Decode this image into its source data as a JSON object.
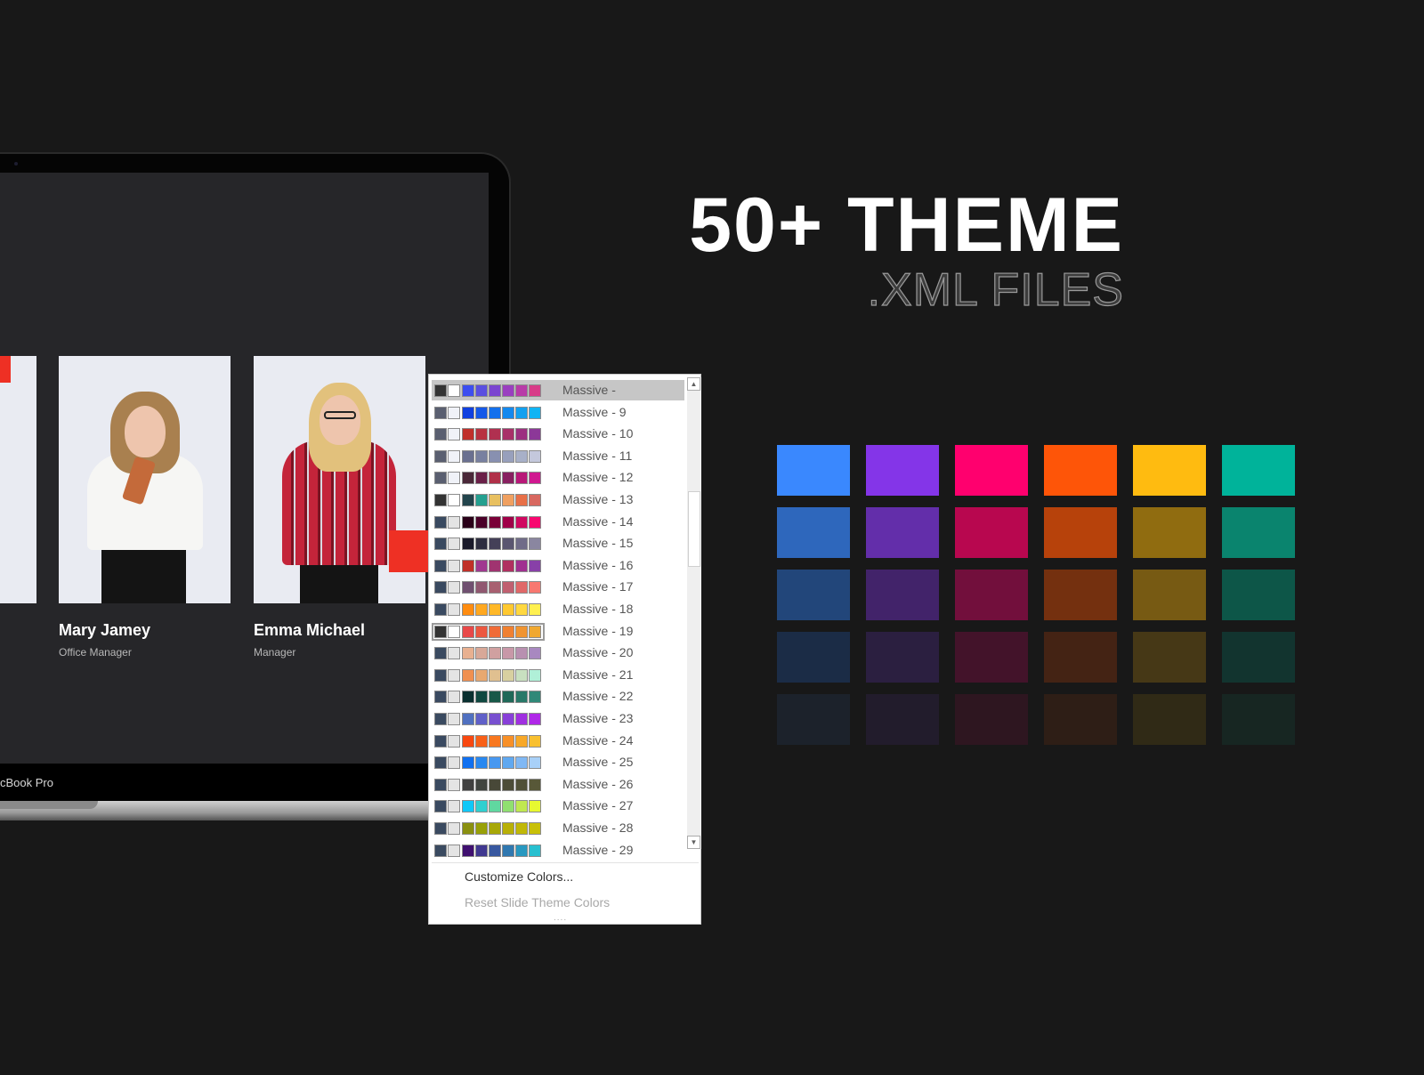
{
  "headline": {
    "title": "50+ THEME",
    "subtitle": ".XML FILES"
  },
  "laptop": {
    "model_label": "cBook Pro",
    "team": [
      {
        "name": "Mary Jamey",
        "role": "Office  Manager"
      },
      {
        "name": "Emma Michael",
        "role": "Manager"
      }
    ],
    "accent": "#ee3024"
  },
  "theme_menu": {
    "selected": "Massive - 19",
    "hovered": "Massive -",
    "scroll_up_icon": "triangle-up",
    "scroll_down_icon": "triangle-down",
    "themes": [
      {
        "label": "Massive -",
        "colors": [
          "#333333",
          "#ffffff",
          "#3c4ef0",
          "#5a4fe0",
          "#7a44d0",
          "#9a3fc0",
          "#b83ca8",
          "#d83c88"
        ]
      },
      {
        "label": "Massive -  9",
        "colors": [
          "#5a5f70",
          "#f0f2f8",
          "#1040e0",
          "#1558e8",
          "#1470ec",
          "#1488ee",
          "#12a0f0",
          "#10b4f4"
        ]
      },
      {
        "label": "Massive - 10",
        "colors": [
          "#5a5f70",
          "#f0f2f8",
          "#c0302a",
          "#b83240",
          "#b03050",
          "#a83068",
          "#9c3080",
          "#8c3898"
        ]
      },
      {
        "label": "Massive - 11",
        "colors": [
          "#5a5f70",
          "#f0f2f8",
          "#6a7090",
          "#7880a0",
          "#8890b0",
          "#98a0bc",
          "#a8b0c8",
          "#c4c8dc"
        ]
      },
      {
        "label": "Massive - 12",
        "colors": [
          "#5a5f70",
          "#f0f2f8",
          "#4a2838",
          "#6a2048",
          "#b03048",
          "#882060",
          "#b81878",
          "#d01890"
        ]
      },
      {
        "label": "Massive - 13",
        "colors": [
          "#333333",
          "#ffffff",
          "#22444c",
          "#24a090",
          "#e8c060",
          "#f0a060",
          "#e87048",
          "#d86860"
        ]
      },
      {
        "label": "Massive - 14",
        "colors": [
          "#3a4a60",
          "#e4e4e4",
          "#2a0018",
          "#4a0028",
          "#7a0038",
          "#a00048",
          "#d00860",
          "#f80870"
        ]
      },
      {
        "label": "Massive - 15",
        "colors": [
          "#3a4a60",
          "#e4e4e4",
          "#1a1a2a",
          "#2e2e40",
          "#444058",
          "#5a5670",
          "#706c88",
          "#8a86a0"
        ]
      },
      {
        "label": "Massive - 16",
        "colors": [
          "#3a4a60",
          "#e4e4e4",
          "#c03028",
          "#a03890",
          "#a03470",
          "#b03060",
          "#a03090",
          "#8840a8"
        ]
      },
      {
        "label": "Massive - 17",
        "colors": [
          "#3a4a60",
          "#e4e4e4",
          "#705070",
          "#905870",
          "#a86070",
          "#c06070",
          "#e06868",
          "#f87870"
        ]
      },
      {
        "label": "Massive - 18",
        "colors": [
          "#3a4a60",
          "#e4e4e4",
          "#ff8c10",
          "#ffa820",
          "#ffb828",
          "#ffc830",
          "#ffd840",
          "#fff050"
        ]
      },
      {
        "label": "Massive - 19",
        "colors": [
          "#333333",
          "#ffffff",
          "#e84848",
          "#ec5840",
          "#f06c38",
          "#f08030",
          "#f09430",
          "#f0a830"
        ]
      },
      {
        "label": "Massive - 20",
        "colors": [
          "#3a4a60",
          "#e4e4e4",
          "#e8b090",
          "#d8a898",
          "#d0a0a0",
          "#c898a8",
          "#b890b0",
          "#a888c0"
        ]
      },
      {
        "label": "Massive - 21",
        "colors": [
          "#3a4a60",
          "#e4e4e4",
          "#f09050",
          "#e8a870",
          "#e0c090",
          "#d8d0a0",
          "#c8e0c0",
          "#b0f0d8"
        ]
      },
      {
        "label": "Massive - 22",
        "colors": [
          "#3a4a60",
          "#e4e4e4",
          "#0a3030",
          "#104840",
          "#185848",
          "#206858",
          "#287868",
          "#308878"
        ]
      },
      {
        "label": "Massive - 23",
        "colors": [
          "#3a4a60",
          "#e4e4e4",
          "#5070c0",
          "#6060c8",
          "#7850d0",
          "#8840d8",
          "#a030e0",
          "#b028e8"
        ]
      },
      {
        "label": "Massive - 24",
        "colors": [
          "#3a4a60",
          "#e4e4e4",
          "#f84810",
          "#f86018",
          "#f87820",
          "#f89028",
          "#f8a828",
          "#f8c030"
        ]
      },
      {
        "label": "Massive - 25",
        "colors": [
          "#3a4a60",
          "#e4e4e4",
          "#1070f0",
          "#2888f0",
          "#4898f0",
          "#60a8f0",
          "#80b8f4",
          "#a8d0f8"
        ]
      },
      {
        "label": "Massive - 26",
        "colors": [
          "#3a4a60",
          "#e4e4e4",
          "#404040",
          "#404440",
          "#484838",
          "#4c4c38",
          "#505038",
          "#585838"
        ]
      },
      {
        "label": "Massive - 27",
        "colors": [
          "#3a4a60",
          "#e4e4e4",
          "#10c8f8",
          "#30d0d0",
          "#60d8a0",
          "#90e070",
          "#c0e850",
          "#e8f830"
        ]
      },
      {
        "label": "Massive - 28",
        "colors": [
          "#3a4a60",
          "#e4e4e4",
          "#8a9010",
          "#98a008",
          "#a8a808",
          "#b8b008",
          "#c0b808",
          "#c8c008"
        ]
      },
      {
        "label": "Massive - 29",
        "colors": [
          "#3a4a60",
          "#e4e4e4",
          "#401070",
          "#403890",
          "#3858a0",
          "#3078b0",
          "#2898c0",
          "#28c0d0"
        ]
      }
    ],
    "customize_label": "Customize Colors...",
    "reset_label": "Reset Slide Theme Colors",
    "grip": "...."
  },
  "palette_grid": [
    [
      "#3a88fe",
      "#8435e8",
      "#ff006e",
      "#fe5508",
      "#ffbb10",
      "#00b39a"
    ],
    [
      "#2e67bc",
      "#632eaa",
      "#b8074f",
      "#b7420b",
      "#906c10",
      "#0a846e"
    ],
    [
      "#22467a",
      "#42236a",
      "#720f3c",
      "#74300f",
      "#775a13",
      "#0d5648"
    ],
    [
      "#1b2c46",
      "#2b1f40",
      "#43132a",
      "#442314",
      "#463816",
      "#12342f"
    ],
    [
      "#1c222b",
      "#221c2c",
      "#2e1620",
      "#2e1e16",
      "#302a16",
      "#172622"
    ]
  ]
}
